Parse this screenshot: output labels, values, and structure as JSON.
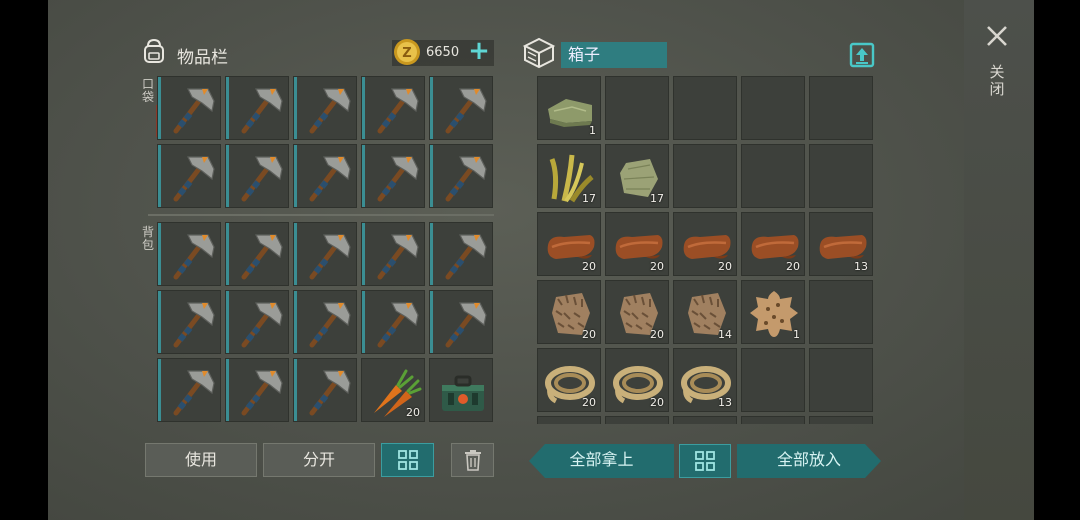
{
  "inventory": {
    "title": "物品栏",
    "coins": "6650",
    "pocket_label": "口袋",
    "backpack_label": "背包",
    "slots": [
      {
        "item": "hatchet-icon"
      },
      {
        "item": "hatchet-icon"
      },
      {
        "item": "hatchet-icon"
      },
      {
        "item": "hatchet-icon"
      },
      {
        "item": "hatchet-icon"
      },
      {
        "item": "hatchet-icon"
      },
      {
        "item": "hatchet-icon"
      },
      {
        "item": "hatchet-icon"
      },
      {
        "item": "hatchet-icon"
      },
      {
        "item": "hatchet-icon"
      },
      {
        "item": "hatchet-icon"
      },
      {
        "item": "hatchet-icon"
      },
      {
        "item": "hatchet-icon"
      },
      {
        "item": "hatchet-icon"
      },
      {
        "item": "hatchet-icon"
      },
      {
        "item": "hatchet-icon"
      },
      {
        "item": "hatchet-icon"
      },
      {
        "item": "hatchet-icon"
      },
      {
        "item": "hatchet-icon"
      },
      {
        "item": "hatchet-icon"
      },
      {
        "item": "hatchet-icon"
      },
      {
        "item": "hatchet-icon"
      },
      {
        "item": "hatchet-icon"
      },
      {
        "item": "carrot-icon",
        "qty": "20"
      },
      {
        "item": "toolbox-icon"
      }
    ],
    "use_label": "使用",
    "split_label": "分开"
  },
  "box": {
    "name": "箱子",
    "rows": [
      [
        {
          "item": "cloth-icon",
          "qty": "1"
        },
        {},
        {},
        {},
        {}
      ],
      [
        {
          "item": "plant-fiber-icon",
          "qty": "17"
        },
        {
          "item": "scrap-cloth-icon",
          "qty": "17"
        },
        {},
        {},
        {}
      ],
      [
        {
          "item": "leather-icon",
          "qty": "20"
        },
        {
          "item": "leather-icon",
          "qty": "20"
        },
        {
          "item": "leather-icon",
          "qty": "20"
        },
        {
          "item": "leather-icon",
          "qty": "20"
        },
        {
          "item": "leather-icon",
          "qty": "13"
        }
      ],
      [
        {
          "item": "fur-icon",
          "qty": "20"
        },
        {
          "item": "fur-icon",
          "qty": "20"
        },
        {
          "item": "fur-icon",
          "qty": "14"
        },
        {
          "item": "hide-icon",
          "qty": "1"
        },
        {}
      ],
      [
        {
          "item": "rope-icon",
          "qty": "20"
        },
        {
          "item": "rope-icon",
          "qty": "20"
        },
        {
          "item": "rope-icon",
          "qty": "13"
        },
        {},
        {}
      ],
      [
        {},
        {},
        {},
        {},
        {}
      ]
    ],
    "take_all_label": "全部拿上",
    "put_all_label": "全部放入"
  },
  "close_label": "关闭",
  "colors": {
    "accent": "#3b9da0",
    "slot": "#3d403b",
    "coin": "#e2b93b"
  }
}
